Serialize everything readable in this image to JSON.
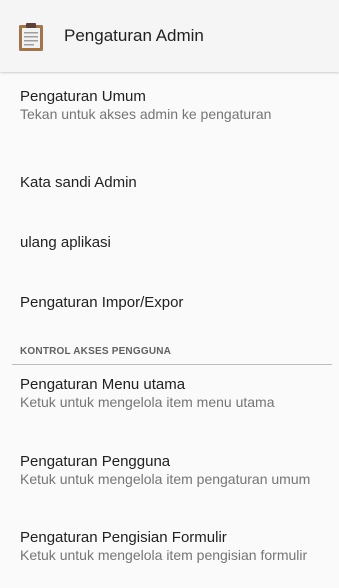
{
  "app_bar": {
    "icon": "clipboard-icon",
    "title": "Pengaturan Admin"
  },
  "colors": {
    "app_bar_bg": "#f5f5f5",
    "list_bg": "#fafafa",
    "title_text": "#212121",
    "summary_text": "#757575",
    "clipboard_board": "#a0754b",
    "clipboard_paper": "#f2f2f2",
    "clipboard_clip": "#5d4037"
  },
  "general": {
    "items": [
      {
        "title": "Pengaturan Umum",
        "summary": "Tekan untuk akses admin ke pengaturan"
      },
      {
        "title": "Kata sandi Admin"
      },
      {
        "title": "ulang aplikasi"
      },
      {
        "title": "Pengaturan Impor/Expor"
      }
    ]
  },
  "access_control": {
    "header": "KONTROL AKSES PENGGUNA",
    "items": [
      {
        "title": "Pengaturan Menu utama",
        "summary": "Ketuk untuk mengelola item menu utama"
      },
      {
        "title": "Pengaturan Pengguna",
        "summary": "Ketuk untuk mengelola item pengaturan umum"
      },
      {
        "title": "Pengaturan Pengisian Formulir",
        "summary": "Ketuk untuk mengelola item pengisian formulir"
      }
    ]
  }
}
